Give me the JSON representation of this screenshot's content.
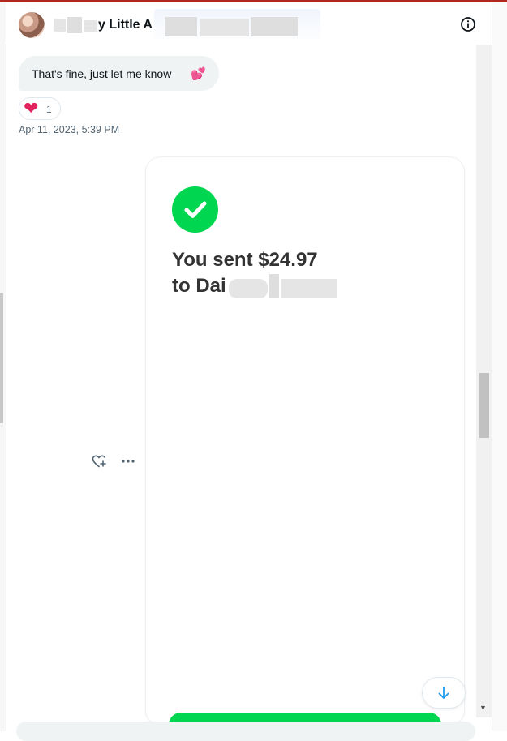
{
  "header": {
    "title_visible": "y Little A",
    "info_icon": "info-icon"
  },
  "messages": {
    "received_text": "That's fine, just let me know",
    "received_emoji": "💕",
    "reaction_emoji": "❤",
    "reaction_count": "1",
    "timestamp": "Apr 11, 2023, 5:39 PM"
  },
  "payment": {
    "line1": "You sent $24.97",
    "line2_visible": "to Dai",
    "status_icon": "checkmark-icon",
    "accent_color": "#00d64f"
  },
  "actions": {
    "like_icon": "heart-plus-icon",
    "more_icon": "more-horizontal-icon"
  },
  "scroll_down_icon": "arrow-down-icon",
  "colors": {
    "heart": "#e0245e",
    "link_blue": "#1d9bf0",
    "top_border": "#b3261e"
  }
}
